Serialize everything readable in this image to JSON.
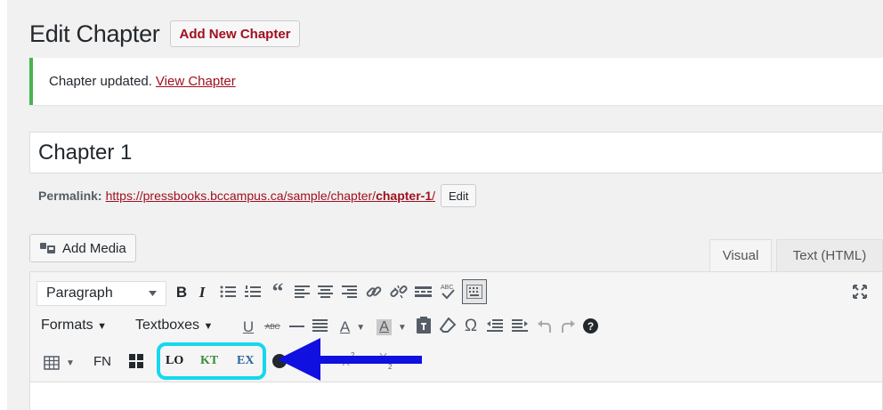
{
  "header": {
    "title": "Edit Chapter",
    "add_new_label": "Add New Chapter"
  },
  "notice": {
    "message": "Chapter updated.",
    "link_label": "View Chapter"
  },
  "post": {
    "title": "Chapter 1",
    "permalink_label": "Permalink:",
    "permalink_base": "https://pressbooks.bccampus.ca/sample/chapter/",
    "permalink_slug": "chapter-1",
    "permalink_trail": "/",
    "edit_label": "Edit"
  },
  "media": {
    "add_media_label": "Add Media"
  },
  "editor_tabs": {
    "visual": "Visual",
    "text": "Text (HTML)"
  },
  "toolbar": {
    "format_value": "Paragraph",
    "formats_label": "Formats",
    "textboxes_label": "Textboxes",
    "footnote_label": "FN",
    "lo_label": "LO",
    "kt_label": "KT",
    "ex_label": "EX",
    "row1_icons": [
      "bold-icon",
      "italic-icon",
      "bullet-list-icon",
      "numbered-list-icon",
      "blockquote-icon",
      "align-left-icon",
      "align-center-icon",
      "align-right-icon",
      "link-icon",
      "unlink-icon",
      "read-more-icon",
      "spellcheck-icon",
      "toolbar-toggle-icon",
      "fullscreen-icon"
    ],
    "row2_icons": [
      "underline-icon",
      "strikethrough-icon",
      "horizontal-line-icon",
      "justify-icon",
      "text-color-icon",
      "background-color-icon",
      "paste-text-icon",
      "clear-formatting-icon",
      "special-character-icon",
      "outdent-icon",
      "indent-icon",
      "undo-icon",
      "redo-icon",
      "help-icon"
    ],
    "row3_icons": [
      "table-icon",
      "grid-icon",
      "circle-icon",
      "superscript-icon",
      "subscript-icon"
    ]
  },
  "colors": {
    "accent_red": "#a00f1f",
    "notice_green": "#46b450",
    "highlight_cyan": "#14d8ee",
    "arrow_blue": "#1010e0",
    "lo_color": "#111111",
    "kt_color": "#3a8a3a",
    "ex_color": "#2e62a0"
  }
}
